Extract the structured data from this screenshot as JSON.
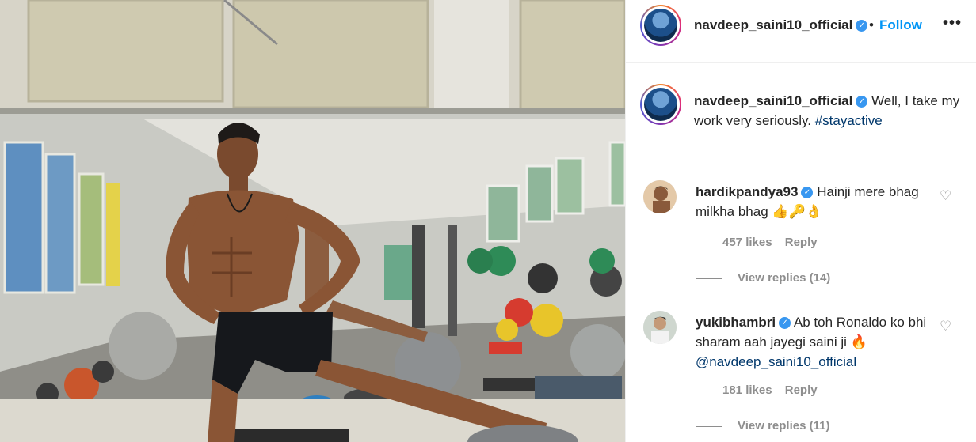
{
  "post": {
    "author": "navdeep_saini10_official",
    "follow_label": "Follow",
    "separator": "•",
    "more_label": "•••",
    "verified_mark": "✓",
    "caption_text": "Well, I take my work very seriously. ",
    "caption_hashtag": "#stayactive"
  },
  "comments": [
    {
      "username": "hardikpandya93",
      "text": "Hainji mere bhag milkha bhag 👍🔑👌",
      "mention": "",
      "likes": "457 likes",
      "reply_label": "Reply",
      "view_replies": "View replies (14)"
    },
    {
      "username": "yukibhambri",
      "text": "Ab toh Ronaldo ko bhi sharam aah jayegi saini ji 🔥",
      "mention": "@navdeep_saini10_official",
      "likes": "181 likes",
      "reply_label": "Reply",
      "view_replies": "View replies (11)"
    }
  ],
  "icons": {
    "heart": "♡",
    "verified": "verified-badge-icon"
  },
  "colors": {
    "link_blue": "#0095f6",
    "hashtag": "#00376b",
    "muted": "#8e8e8e",
    "verified": "#3897f0"
  }
}
